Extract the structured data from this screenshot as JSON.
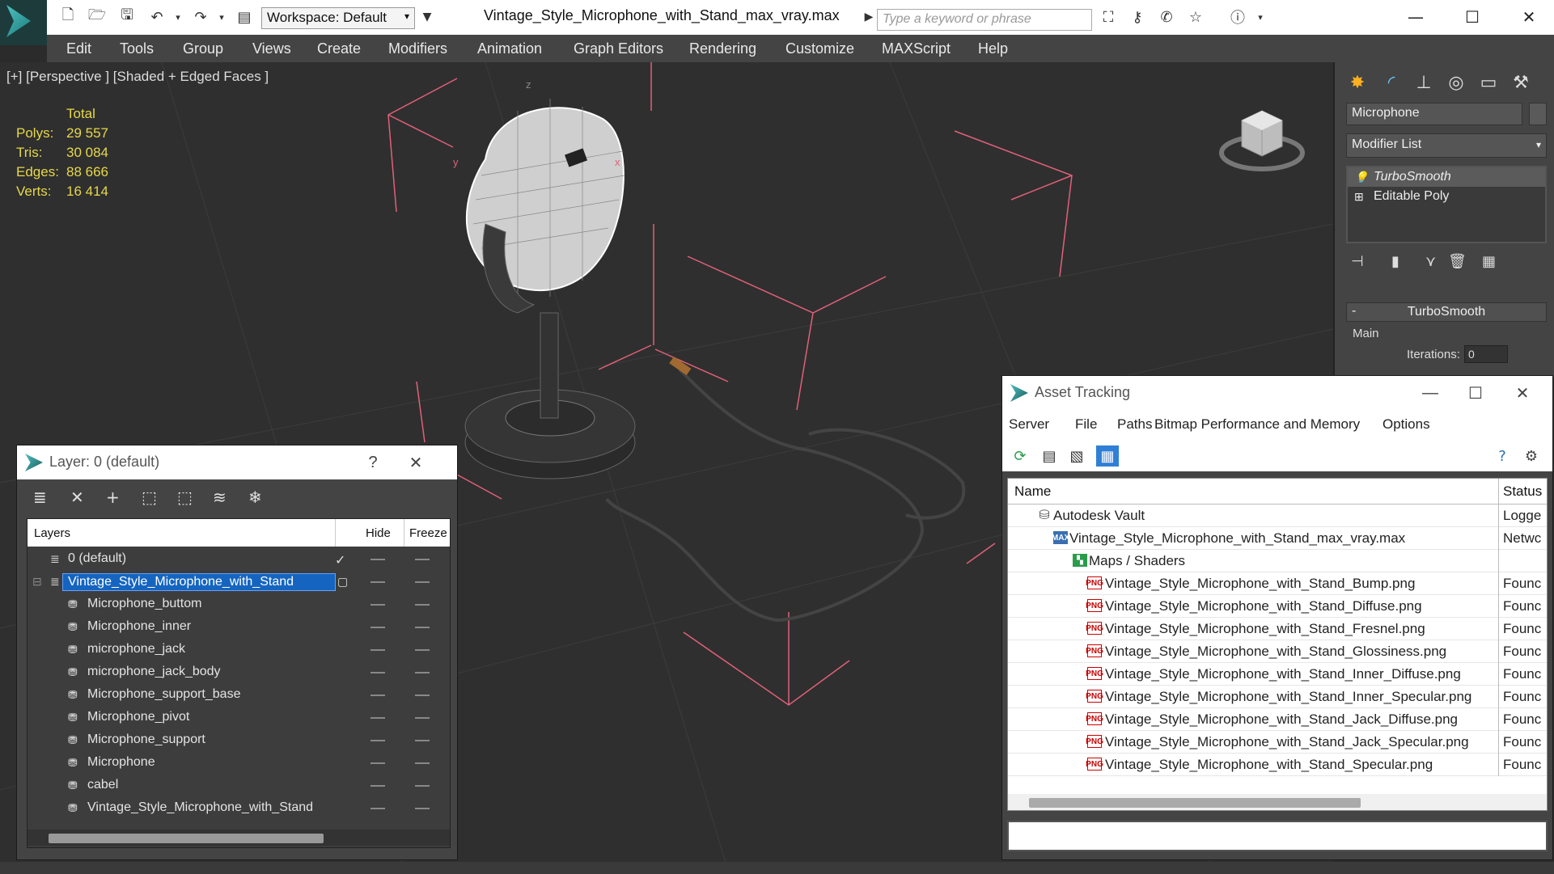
{
  "window": {
    "title": "Vintage_Style_Microphone_with_Stand_max_vray.max",
    "workspace": "Workspace: Default",
    "search_placeholder": "Type a keyword or phrase"
  },
  "menu": [
    "Edit",
    "Tools",
    "Group",
    "Views",
    "Create",
    "Modifiers",
    "Animation",
    "Graph Editors",
    "Rendering",
    "Customize",
    "MAXScript",
    "Help"
  ],
  "viewport": {
    "label": "[+] [Perspective ] [Shaded + Edged Faces ]",
    "stats": {
      "header": "Total",
      "rows": [
        {
          "label": "Polys:",
          "value": "29 557"
        },
        {
          "label": "Tris:",
          "value": "30 084"
        },
        {
          "label": "Edges:",
          "value": "88 666"
        },
        {
          "label": "Verts:",
          "value": "16 414"
        }
      ]
    },
    "axis_labels": {
      "z": "z",
      "y": "y",
      "x": "x"
    }
  },
  "command_panel": {
    "object_name": "Microphone",
    "modifier_list": "Modifier List",
    "stack": [
      "TurboSmooth",
      "Editable Poly"
    ],
    "rollout_title": "TurboSmooth",
    "rollout_minus": "-",
    "main_label": "Main",
    "iterations_label": "Iterations:",
    "iterations_value": "0"
  },
  "layer_window": {
    "title": "Layer: 0 (default)",
    "help": "?",
    "columns": {
      "layers": "Layers",
      "hide": "Hide",
      "freeze": "Freeze"
    },
    "rows": [
      {
        "name": "0 (default)",
        "level": 0,
        "checked": true
      },
      {
        "name": "Vintage_Style_Microphone_with_Stand",
        "level": 0,
        "selected": true
      },
      {
        "name": "Microphone_buttom",
        "level": 1
      },
      {
        "name": "Microphone_inner",
        "level": 1
      },
      {
        "name": "microphone_jack",
        "level": 1
      },
      {
        "name": "microphone_jack_body",
        "level": 1
      },
      {
        "name": "Microphone_support_base",
        "level": 1
      },
      {
        "name": "Microphone_pivot",
        "level": 1
      },
      {
        "name": "Microphone_support",
        "level": 1
      },
      {
        "name": "Microphone",
        "level": 1
      },
      {
        "name": "cabel",
        "level": 1
      },
      {
        "name": "Vintage_Style_Microphone_with_Stand",
        "level": 1
      }
    ]
  },
  "asset_window": {
    "title": "Asset Tracking",
    "menu": [
      "Server",
      "File",
      "Paths",
      "Bitmap Performance and Memory",
      "Options"
    ],
    "columns": {
      "name": "Name",
      "status": "Status"
    },
    "rows": [
      {
        "name": "Autodesk Vault",
        "level": 0,
        "icon": "vault",
        "status": "Logge"
      },
      {
        "name": "Vintage_Style_Microphone_with_Stand_max_vray.max",
        "level": 1,
        "icon": "max",
        "status": "Netwc"
      },
      {
        "name": "Maps / Shaders",
        "level": 2,
        "icon": "maps",
        "status": ""
      },
      {
        "name": "Vintage_Style_Microphone_with_Stand_Bump.png",
        "level": 3,
        "icon": "png",
        "status": "Founc"
      },
      {
        "name": "Vintage_Style_Microphone_with_Stand_Diffuse.png",
        "level": 3,
        "icon": "png",
        "status": "Founc"
      },
      {
        "name": "Vintage_Style_Microphone_with_Stand_Fresnel.png",
        "level": 3,
        "icon": "png",
        "status": "Founc"
      },
      {
        "name": "Vintage_Style_Microphone_with_Stand_Glossiness.png",
        "level": 3,
        "icon": "png",
        "status": "Founc"
      },
      {
        "name": "Vintage_Style_Microphone_with_Stand_Inner_Diffuse.png",
        "level": 3,
        "icon": "png",
        "status": "Founc"
      },
      {
        "name": "Vintage_Style_Microphone_with_Stand_Inner_Specular.png",
        "level": 3,
        "icon": "png",
        "status": "Founc"
      },
      {
        "name": "Vintage_Style_Microphone_with_Stand_Jack_Diffuse.png",
        "level": 3,
        "icon": "png",
        "status": "Founc"
      },
      {
        "name": "Vintage_Style_Microphone_with_Stand_Jack_Specular.png",
        "level": 3,
        "icon": "png",
        "status": "Founc"
      },
      {
        "name": "Vintage_Style_Microphone_with_Stand_Specular.png",
        "level": 3,
        "icon": "png",
        "status": "Founc"
      }
    ]
  },
  "colors": {
    "selection": "#1565c0",
    "gizmo": "#e0607a",
    "stats_text": "#e6d84a"
  }
}
